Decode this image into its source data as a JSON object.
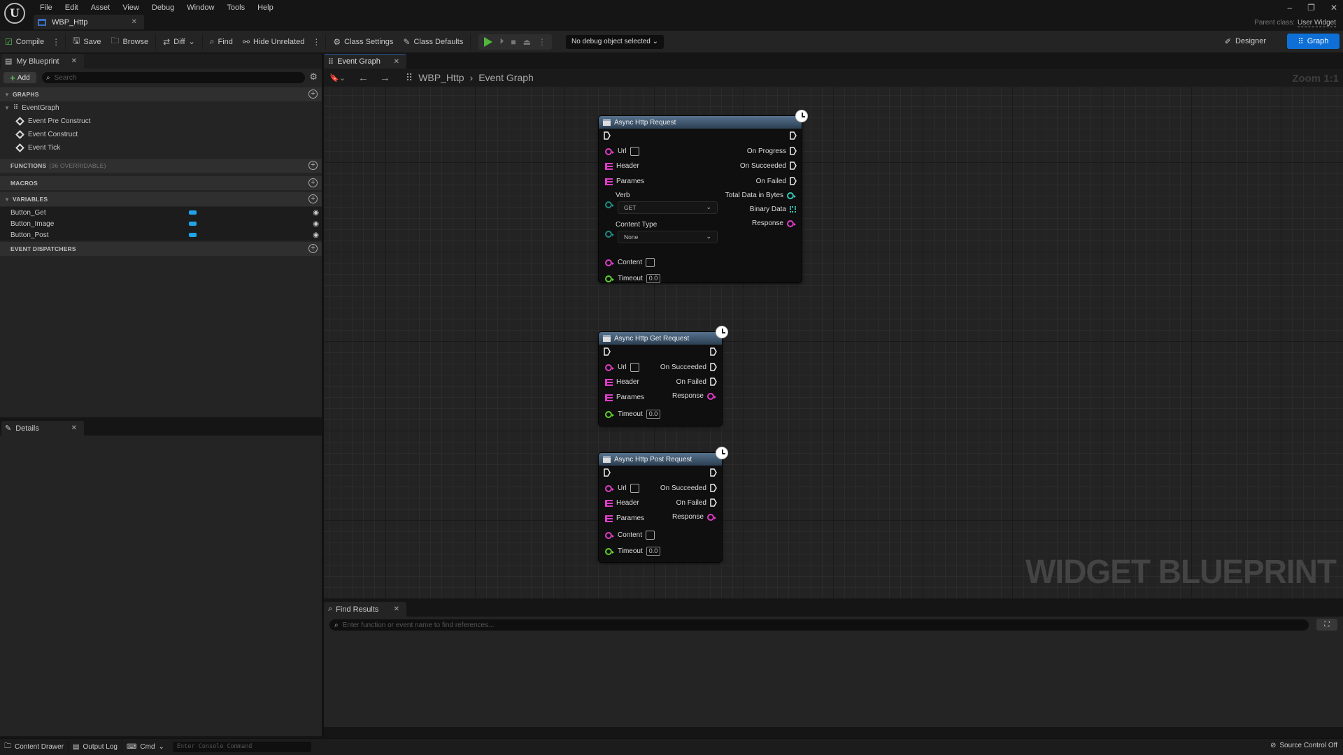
{
  "app": {
    "menu": [
      "File",
      "Edit",
      "Asset",
      "View",
      "Debug",
      "Window",
      "Tools",
      "Help"
    ],
    "asset_tab": "WBP_Http",
    "parent_class_label": "Parent class:",
    "parent_class_value": "User Widget",
    "window_controls": {
      "minimize": "–",
      "restore": "❐",
      "close": "✕"
    }
  },
  "toolbar": {
    "compile": "Compile",
    "save": "Save",
    "browse": "Browse",
    "diff": "Diff",
    "find": "Find",
    "hide_unrelated": "Hide Unrelated",
    "class_settings": "Class Settings",
    "class_defaults": "Class Defaults",
    "debug_object": "No debug object selected",
    "designer": "Designer",
    "graph": "Graph"
  },
  "my_blueprint": {
    "tab": "My Blueprint",
    "add": "Add",
    "search_placeholder": "Search",
    "sections": {
      "graphs": "GRAPHS",
      "functions": "FUNCTIONS",
      "functions_sub": "(36 OVERRIDABLE)",
      "macros": "MACROS",
      "variables": "VARIABLES",
      "event_dispatchers": "EVENT DISPATCHERS"
    },
    "event_graph": "EventGraph",
    "events": [
      "Event Pre Construct",
      "Event Construct",
      "Event Tick"
    ],
    "variables": [
      "Button_Get",
      "Button_Image",
      "Button_Post"
    ],
    "variable_type_color": "#20a4e8"
  },
  "details": {
    "tab": "Details"
  },
  "graph": {
    "tab": "Event Graph",
    "breadcrumb": [
      "WBP_Http",
      "Event Graph"
    ],
    "zoom": "Zoom 1:1",
    "watermark": "WIDGET BLUEPRINT",
    "nodes": [
      {
        "title": "Async Http Request",
        "inputs": [
          "Url",
          "Header",
          "Parames",
          "Verb",
          "Content Type",
          "Content",
          "Timeout"
        ],
        "verb_value": "GET",
        "content_type_value": "None",
        "timeout_value": "0.0",
        "outputs": [
          "On Progress",
          "On Succeeded",
          "On Failed",
          "Total Data in Bytes",
          "Binary Data",
          "Response"
        ]
      },
      {
        "title": "Async Http Get Request",
        "inputs": [
          "Url",
          "Header",
          "Parames",
          "Timeout"
        ],
        "timeout_value": "0.0",
        "outputs": [
          "On Succeeded",
          "On Failed",
          "Response"
        ]
      },
      {
        "title": "Async Http Post Request",
        "inputs": [
          "Url",
          "Header",
          "Parames",
          "Content",
          "Timeout"
        ],
        "timeout_value": "0.0",
        "outputs": [
          "On Succeeded",
          "On Failed",
          "Response"
        ]
      }
    ]
  },
  "find_results": {
    "tab": "Find Results",
    "placeholder": "Enter function or event name to find references..."
  },
  "statusbar": {
    "content_drawer": "Content Drawer",
    "output_log": "Output Log",
    "cmd": "Cmd",
    "console_placeholder": "Enter Console Command",
    "source_control": "Source Control Off"
  }
}
